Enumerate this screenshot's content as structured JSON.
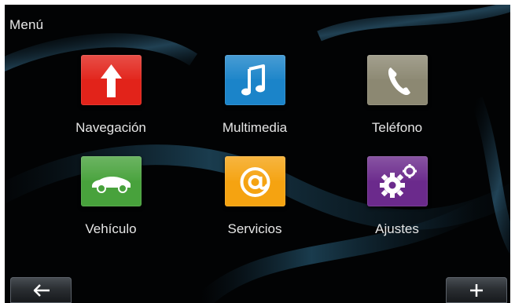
{
  "screen": {
    "title": "Menú"
  },
  "tiles": [
    {
      "label": "Navegación",
      "icon": "navigation-arrow-icon",
      "color": "#e2231a"
    },
    {
      "label": "Multimedia",
      "icon": "music-note-icon",
      "color": "#1b84c9"
    },
    {
      "label": "Teléfono",
      "icon": "phone-handset-icon",
      "color": "#8c8872"
    },
    {
      "label": "Vehículo",
      "icon": "car-icon",
      "color": "#48a23c"
    },
    {
      "label": "Servicios",
      "icon": "at-sign-icon",
      "color": "#f5a311"
    },
    {
      "label": "Ajustes",
      "icon": "gears-icon",
      "color": "#6b2a8c"
    }
  ],
  "bottom_bar": {
    "back_icon": "arrow-left-icon",
    "add_icon": "plus-icon"
  }
}
